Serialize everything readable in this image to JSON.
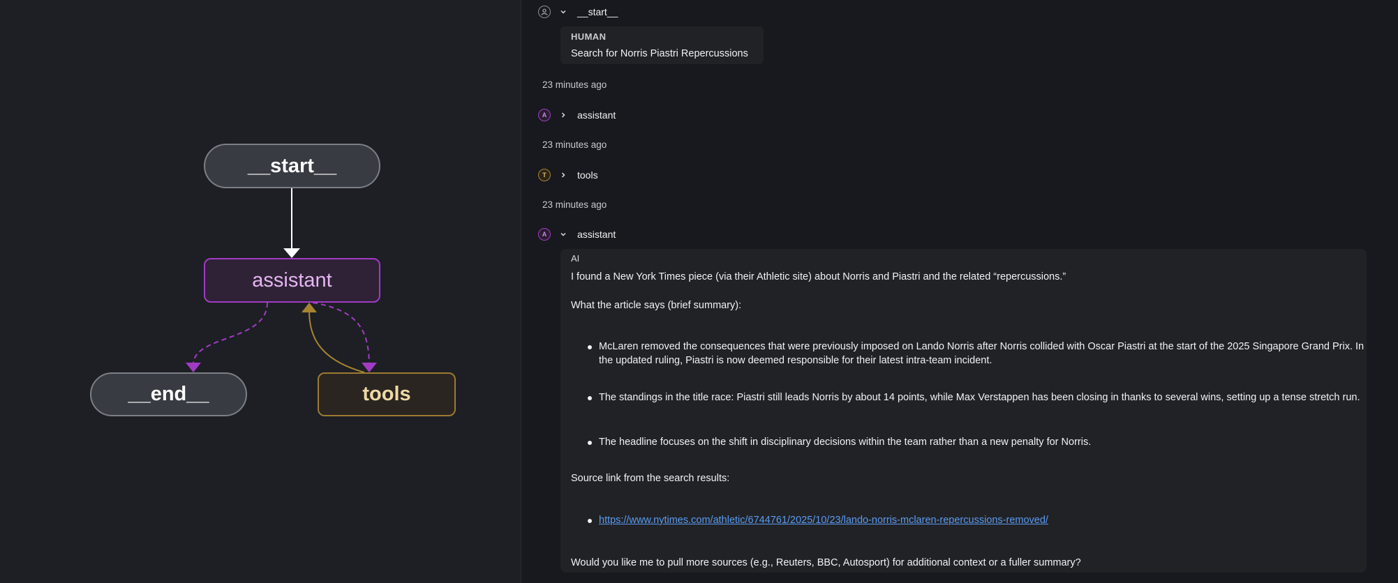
{
  "graph": {
    "nodes": {
      "start": "__start__",
      "assistant": "assistant",
      "end": "__end__",
      "tools": "tools"
    },
    "colors": {
      "start_edge": "#ffffff",
      "conditional_edge": "#a23bc4",
      "tools_edge": "#a7842f"
    }
  },
  "thread": {
    "entries": [
      {
        "avatar": "user-icon",
        "node": "__start__",
        "expanded": true
      },
      {
        "avatar": "A",
        "node": "assistant",
        "expanded": false
      },
      {
        "avatar": "T",
        "node": "tools",
        "expanded": false
      },
      {
        "avatar": "A",
        "node": "assistant",
        "expanded": true
      }
    ],
    "timestamps": [
      "23 minutes ago",
      "23 minutes ago",
      "23 minutes ago"
    ],
    "human_card": {
      "role": "HUMAN",
      "message": "Search for Norris Piastri Repercussions"
    },
    "ai_card": {
      "role": "AI",
      "intro": "I found a New York Times piece (via their Athletic site) about Norris and Piastri and the related “repercussions.”",
      "summary_heading": "What the article says (brief summary):",
      "bullets": [
        "McLaren removed the consequences that were previously imposed on Lando Norris after Norris collided with Oscar Piastri at the start of the 2025 Singapore Grand Prix. In the updated ruling, Piastri is now deemed responsible for their latest intra-team incident.",
        "The standings in the title race: Piastri still leads Norris by about 14 points, while Max Verstappen has been closing in thanks to several wins, setting up a tense stretch run.",
        "The headline focuses on the shift in disciplinary decisions within the team rather than a new penalty for Norris."
      ],
      "source_heading": "Source link from the search results:",
      "source_link": "https://www.nytimes.com/athletic/6744761/2025/10/23/lando-norris-mclaren-repercussions-removed/",
      "follow_up": "Would you like me to pull more sources (e.g., Reuters, BBC, Autosport) for additional context or a fuller summary?"
    }
  }
}
